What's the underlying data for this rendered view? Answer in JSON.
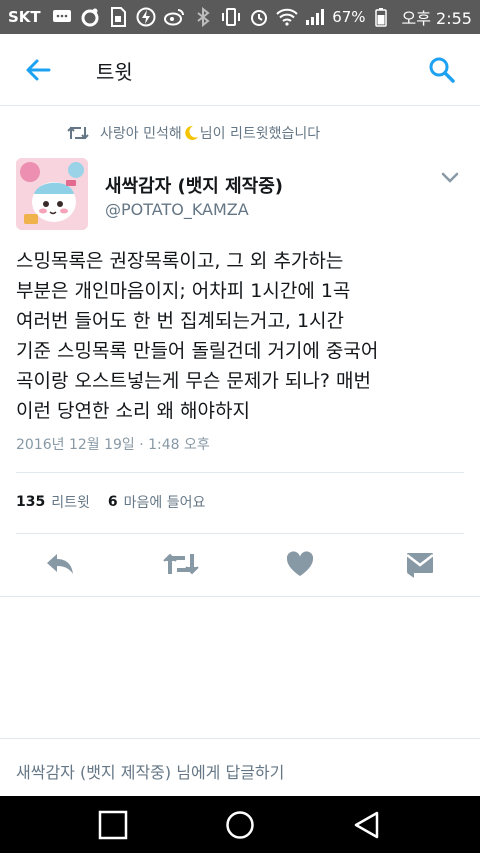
{
  "status_bar": {
    "carrier": "SKT",
    "battery_percent": "67%",
    "time": "오후 2:55",
    "icons": [
      "message-icon",
      "circle-app-icon",
      "sim-icon",
      "lightning-icon",
      "weibo-icon",
      "bluetooth-icon",
      "vibrate-icon",
      "alarm-icon",
      "wifi-icon",
      "signal-icon",
      "battery-icon"
    ]
  },
  "app_bar": {
    "title": "트윗",
    "back_icon": "arrow-left-icon",
    "search_icon": "search-icon",
    "accent_color": "#1da1f2"
  },
  "retweet_note": {
    "text_before": "사랑아 민석해",
    "emoji": "crescent-moon",
    "text_after": " 님이 리트윗했습니다"
  },
  "tweet": {
    "author_name": "새싹감자 (뱃지 제작중)",
    "author_handle": "@POTATO_KAMZA",
    "text": "스밍목록은 권장목록이고, 그 외 추가하는\n부분은 개인마음이지; 어차피 1시간에 1곡\n여러번 들어도 한 번 집계되는거고, 1시간\n기준 스밍목록 만들어 돌릴건데 거기에 중국어\n곡이랑 오스트넣는게 무슨 문제가 되나? 매번\n이런 당연한 소리 왜 해야하지",
    "timestamp": "2016년 12월 19일 · 1:48 오후"
  },
  "stats": {
    "retweets_count": "135",
    "retweets_label": "리트윗",
    "likes_count": "6",
    "likes_label": "마음에 들어요"
  },
  "actions": [
    "reply-icon",
    "retweet-icon",
    "heart-icon",
    "message-envelope-icon"
  ],
  "reply_box": {
    "placeholder": "새싹감자 (뱃지 제작중) 님에게 답글하기"
  },
  "nav_bar": [
    "recent-apps-square-icon",
    "home-circle-icon",
    "back-triangle-icon"
  ]
}
